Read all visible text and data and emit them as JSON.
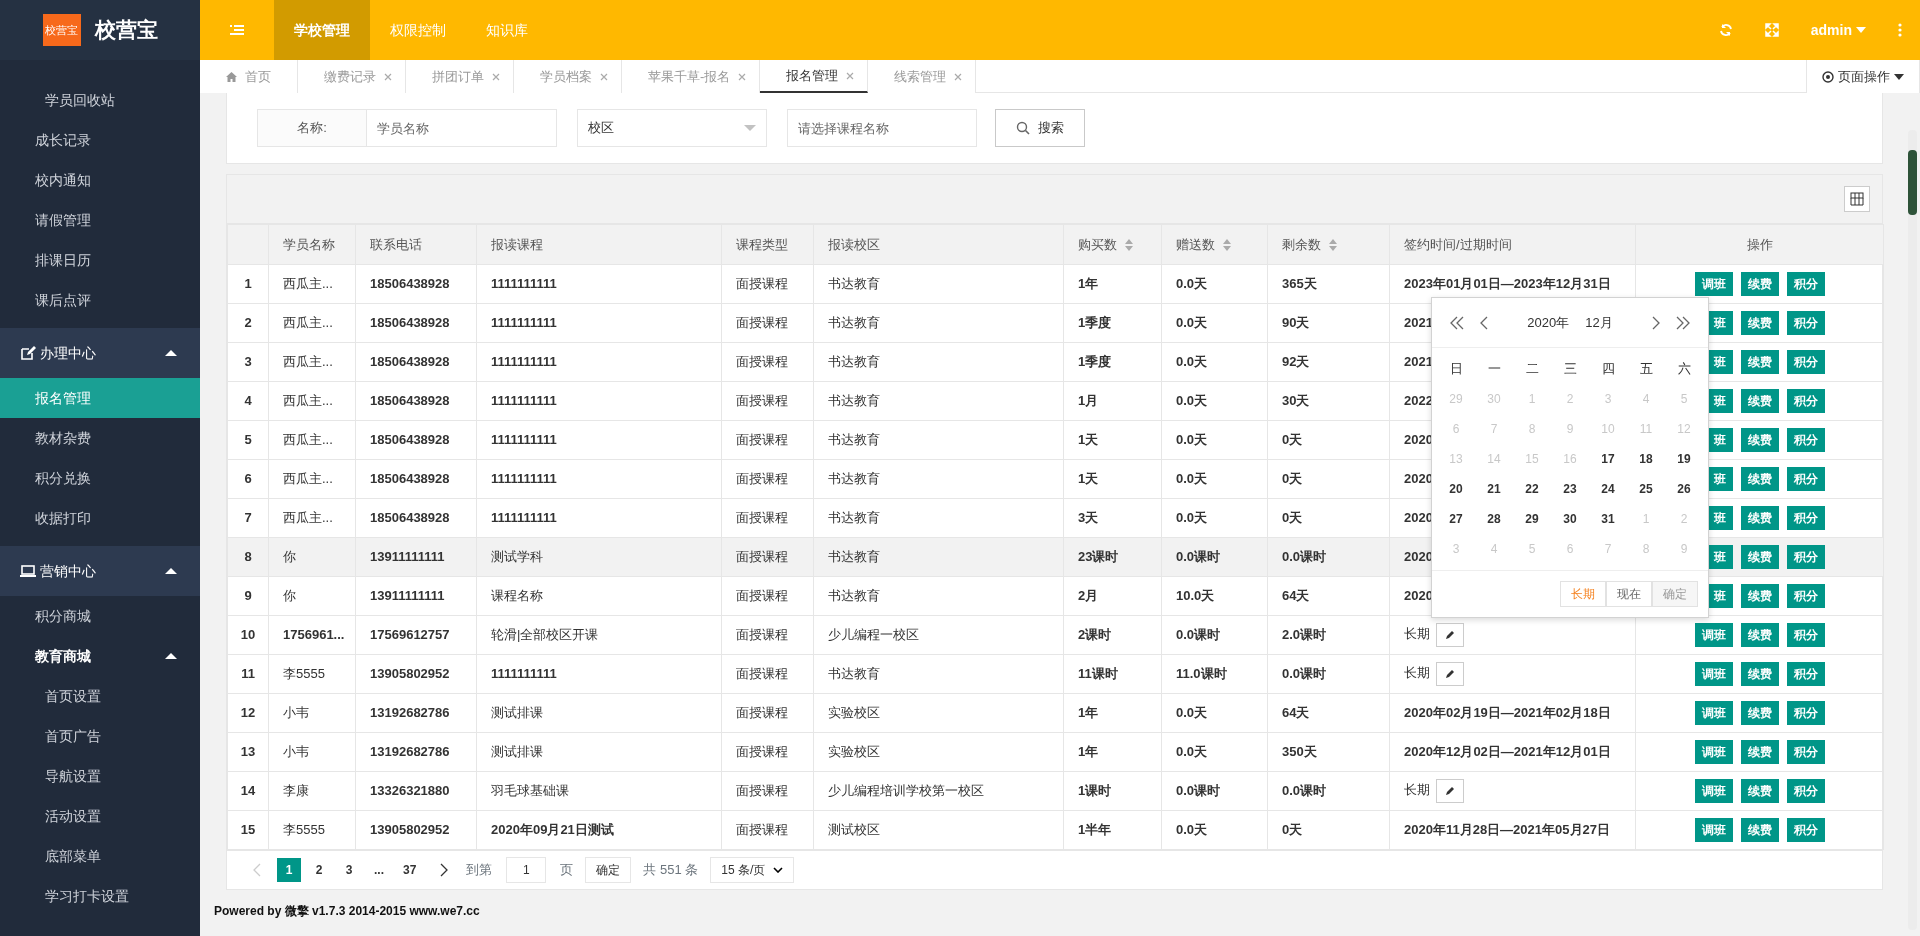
{
  "app": {
    "logo_badge": "校营宝",
    "logo_text": "校营宝"
  },
  "top_nav": {
    "items": [
      {
        "label": "学校管理",
        "selected": true
      },
      {
        "label": "权限控制",
        "selected": false
      },
      {
        "label": "知识库",
        "selected": false
      }
    ],
    "user": "admin"
  },
  "tabs": [
    {
      "label": "首页",
      "kind": "home",
      "selected": false
    },
    {
      "label": "缴费记录",
      "kind": "closable",
      "selected": false
    },
    {
      "label": "拼团订单",
      "kind": "closable",
      "selected": false
    },
    {
      "label": "学员档案",
      "kind": "closable",
      "selected": false
    },
    {
      "label": "苹果千草-报名",
      "kind": "closable",
      "selected": false
    },
    {
      "label": "报名管理",
      "kind": "closable",
      "selected": true
    },
    {
      "label": "线索管理",
      "kind": "closable",
      "selected": false
    }
  ],
  "page_menu": "页面操作",
  "sidebar": {
    "items": [
      {
        "kind": "subitem",
        "label": "学员回收站",
        "selected": false
      },
      {
        "kind": "item",
        "label": "成长记录",
        "selected": false
      },
      {
        "kind": "item",
        "label": "校内通知",
        "selected": false
      },
      {
        "kind": "item",
        "label": "请假管理",
        "selected": false
      },
      {
        "kind": "item",
        "label": "排课日历",
        "selected": false
      },
      {
        "kind": "item",
        "label": "课后点评",
        "selected": false
      },
      {
        "kind": "group",
        "label": "办理中心",
        "expanded": true,
        "children": [
          {
            "label": "报名管理",
            "selected": true
          },
          {
            "label": "教材杂费",
            "selected": false
          },
          {
            "label": "积分兑换",
            "selected": false
          },
          {
            "label": "收据打印",
            "selected": false
          }
        ]
      },
      {
        "kind": "group",
        "label": "营销中心",
        "expanded": true,
        "children": [
          {
            "label": "积分商城",
            "selected": false
          },
          {
            "label": "教育商城",
            "selected": false,
            "expanded": true,
            "children": [
              {
                "label": "首页设置",
                "selected": false
              },
              {
                "label": "首页广告",
                "selected": false
              },
              {
                "label": "导航设置",
                "selected": false
              },
              {
                "label": "活动设置",
                "selected": false
              },
              {
                "label": "底部菜单",
                "selected": false
              },
              {
                "label": "学习打卡设置",
                "selected": false
              }
            ]
          }
        ]
      }
    ]
  },
  "search": {
    "name_label": "名称:",
    "name_placeholder": "学员名称",
    "campus_placeholder": "校区",
    "course_placeholder": "请选择课程名称",
    "button": "搜索"
  },
  "table": {
    "columns": [
      {
        "sortable": false
      },
      {
        "label": "学员名称",
        "sortable": false
      },
      {
        "label": "联系电话",
        "sortable": false
      },
      {
        "label": "报读课程",
        "sortable": false
      },
      {
        "label": "课程类型",
        "sortable": false
      },
      {
        "label": "报读校区",
        "sortable": false
      },
      {
        "label": "购买数",
        "sortable": true
      },
      {
        "label": "赠送数",
        "sortable": true
      },
      {
        "label": "剩余数",
        "sortable": true
      },
      {
        "label": "签约时间/过期时间",
        "sortable": false
      },
      {
        "label": "操作",
        "sortable": false
      }
    ],
    "rows": [
      {
        "index": "1",
        "name": "西瓜主...",
        "phone": "18506438928",
        "course": "1111111111",
        "type": "面授课程",
        "campus": "书达教育",
        "bought": "1年",
        "gift": "0.0天",
        "remaining": "365天",
        "signing": "2023年01月01日—2023年12月31日",
        "editable": false,
        "hovered": false,
        "actions": [
          "调班",
          "续费",
          "积分"
        ]
      },
      {
        "index": "2",
        "name": "西瓜主...",
        "phone": "18506438928",
        "course": "1111111111",
        "type": "面授课程",
        "campus": "书达教育",
        "bought": "1季度",
        "gift": "0.0天",
        "remaining": "90天",
        "signing": "2021",
        "editable": false,
        "hovered": false,
        "actions": [
          "班",
          "续费",
          "积分"
        ]
      },
      {
        "index": "3",
        "name": "西瓜主...",
        "phone": "18506438928",
        "course": "1111111111",
        "type": "面授课程",
        "campus": "书达教育",
        "bought": "1季度",
        "gift": "0.0天",
        "remaining": "92天",
        "signing": "2021",
        "editable": false,
        "hovered": false,
        "actions": [
          "班",
          "续费",
          "积分"
        ]
      },
      {
        "index": "4",
        "name": "西瓜主...",
        "phone": "18506438928",
        "course": "1111111111",
        "type": "面授课程",
        "campus": "书达教育",
        "bought": "1月",
        "gift": "0.0天",
        "remaining": "30天",
        "signing": "2022",
        "editable": false,
        "hovered": false,
        "actions": [
          "班",
          "续费",
          "积分"
        ]
      },
      {
        "index": "5",
        "name": "西瓜主...",
        "phone": "18506438928",
        "course": "1111111111",
        "type": "面授课程",
        "campus": "书达教育",
        "bought": "1天",
        "gift": "0.0天",
        "remaining": "0天",
        "signing": "2020",
        "editable": false,
        "hovered": false,
        "actions": [
          "班",
          "续费",
          "积分"
        ]
      },
      {
        "index": "6",
        "name": "西瓜主...",
        "phone": "18506438928",
        "course": "1111111111",
        "type": "面授课程",
        "campus": "书达教育",
        "bought": "1天",
        "gift": "0.0天",
        "remaining": "0天",
        "signing": "2020",
        "editable": false,
        "hovered": false,
        "actions": [
          "班",
          "续费",
          "积分"
        ]
      },
      {
        "index": "7",
        "name": "西瓜主...",
        "phone": "18506438928",
        "course": "1111111111",
        "type": "面授课程",
        "campus": "书达教育",
        "bought": "3天",
        "gift": "0.0天",
        "remaining": "0天",
        "signing": "2020",
        "editable": false,
        "hovered": false,
        "actions": [
          "班",
          "续费",
          "积分"
        ]
      },
      {
        "index": "8",
        "name": "你",
        "phone": "13911111111",
        "course": "测试学科",
        "type": "面授课程",
        "campus": "书达教育",
        "bought": "23课时",
        "gift": "0.0课时",
        "remaining": "0.0课时",
        "signing": "2020",
        "editable": false,
        "hovered": true,
        "actions": [
          "班",
          "续费",
          "积分"
        ]
      },
      {
        "index": "9",
        "name": "你",
        "phone": "13911111111",
        "course": "课程名称",
        "type": "面授课程",
        "campus": "书达教育",
        "bought": "2月",
        "gift": "10.0天",
        "remaining": "64天",
        "signing": "2020",
        "editable": false,
        "hovered": false,
        "actions": [
          "班",
          "续费",
          "积分"
        ]
      },
      {
        "index": "10",
        "name": "1756961...",
        "phone": "17569612757",
        "course": "轮滑|全部校区开课",
        "type": "面授课程",
        "campus": "少儿编程一校区",
        "bought": "2课时",
        "gift": "0.0课时",
        "remaining": "2.0课时",
        "signing": "长期",
        "editable": true,
        "hovered": false,
        "actions": [
          "调班",
          "续费",
          "积分"
        ]
      },
      {
        "index": "11",
        "name": "李5555",
        "phone": "13905802952",
        "course": "1111111111",
        "type": "面授课程",
        "campus": "书达教育",
        "bought": "11课时",
        "gift": "11.0课时",
        "remaining": "0.0课时",
        "signing": "长期",
        "editable": true,
        "hovered": false,
        "actions": [
          "调班",
          "续费",
          "积分"
        ]
      },
      {
        "index": "12",
        "name": "小韦",
        "phone": "13192682786",
        "course": "测试排课",
        "type": "面授课程",
        "campus": "实验校区",
        "bought": "1年",
        "gift": "0.0天",
        "remaining": "64天",
        "signing": "2020年02月19日—2021年02月18日",
        "editable": false,
        "hovered": false,
        "actions": [
          "调班",
          "续费",
          "积分"
        ]
      },
      {
        "index": "13",
        "name": "小韦",
        "phone": "13192682786",
        "course": "测试排课",
        "type": "面授课程",
        "campus": "实验校区",
        "bought": "1年",
        "gift": "0.0天",
        "remaining": "350天",
        "signing": "2020年12月02日—2021年12月01日",
        "editable": false,
        "hovered": false,
        "actions": [
          "调班",
          "续费",
          "积分"
        ]
      },
      {
        "index": "14",
        "name": "李康",
        "phone": "13326321880",
        "course": "羽毛球基础课",
        "type": "面授课程",
        "campus": "少儿编程培训学校第一校区",
        "bought": "1课时",
        "gift": "0.0课时",
        "remaining": "0.0课时",
        "signing": "长期",
        "editable": true,
        "hovered": false,
        "actions": [
          "调班",
          "续费",
          "积分"
        ]
      },
      {
        "index": "15",
        "name": "李5555",
        "phone": "13905802952",
        "course": "2020年09月21日测试",
        "type": "面授课程",
        "campus": "测试校区",
        "bought": "1半年",
        "gift": "0.0天",
        "remaining": "0天",
        "signing": "2020年11月28日—2021年05月27日",
        "editable": false,
        "hovered": false,
        "actions": [
          "调班",
          "续费",
          "积分"
        ]
      }
    ]
  },
  "calendar": {
    "year": "2020年",
    "month": "12月",
    "weekdays": [
      "日",
      "一",
      "二",
      "三",
      "四",
      "五",
      "六"
    ],
    "days": [
      {
        "day": "29",
        "disabled": true
      },
      {
        "day": "30",
        "disabled": true
      },
      {
        "day": "1",
        "disabled": true
      },
      {
        "day": "2",
        "disabled": true
      },
      {
        "day": "3",
        "disabled": true
      },
      {
        "day": "4",
        "disabled": true
      },
      {
        "day": "5",
        "disabled": true
      },
      {
        "day": "6",
        "disabled": true
      },
      {
        "day": "7",
        "disabled": true
      },
      {
        "day": "8",
        "disabled": true
      },
      {
        "day": "9",
        "disabled": true
      },
      {
        "day": "10",
        "disabled": true
      },
      {
        "day": "11",
        "disabled": true
      },
      {
        "day": "12",
        "disabled": true
      },
      {
        "day": "13",
        "disabled": true
      },
      {
        "day": "14",
        "disabled": true
      },
      {
        "day": "15",
        "disabled": true
      },
      {
        "day": "16",
        "disabled": true
      },
      {
        "day": "17",
        "disabled": false
      },
      {
        "day": "18",
        "disabled": false
      },
      {
        "day": "19",
        "disabled": false
      },
      {
        "day": "20",
        "disabled": false
      },
      {
        "day": "21",
        "disabled": false
      },
      {
        "day": "22",
        "disabled": false
      },
      {
        "day": "23",
        "disabled": false
      },
      {
        "day": "24",
        "disabled": false
      },
      {
        "day": "25",
        "disabled": false
      },
      {
        "day": "26",
        "disabled": false
      },
      {
        "day": "27",
        "disabled": false
      },
      {
        "day": "28",
        "disabled": false
      },
      {
        "day": "29",
        "disabled": false
      },
      {
        "day": "30",
        "disabled": false
      },
      {
        "day": "31",
        "disabled": false
      },
      {
        "day": "1",
        "disabled": true
      },
      {
        "day": "2",
        "disabled": true
      },
      {
        "day": "3",
        "disabled": true
      },
      {
        "day": "4",
        "disabled": true
      },
      {
        "day": "5",
        "disabled": true
      },
      {
        "day": "6",
        "disabled": true
      },
      {
        "day": "7",
        "disabled": true
      },
      {
        "day": "8",
        "disabled": true
      },
      {
        "day": "9",
        "disabled": true
      }
    ],
    "buttons": [
      {
        "label": "长期",
        "selected": true,
        "disabled": false
      },
      {
        "label": "现在",
        "selected": false,
        "disabled": false
      },
      {
        "label": "确定",
        "selected": false,
        "disabled": true
      }
    ]
  },
  "pagination": {
    "pages": [
      {
        "label": "1",
        "selected": true
      },
      {
        "label": "2",
        "selected": false
      },
      {
        "label": "3",
        "selected": false
      },
      {
        "label": "...",
        "selected": false
      },
      {
        "label": "37",
        "selected": false
      }
    ],
    "prev_disabled": true,
    "goto_label": "到第",
    "goto_value": "1",
    "page_unit": "页",
    "confirm": "确定",
    "total": "共 551 条",
    "page_size": "15 条/页"
  },
  "footer": "Powered by 微擎 v1.7.3 2014-2015 www.we7.cc"
}
